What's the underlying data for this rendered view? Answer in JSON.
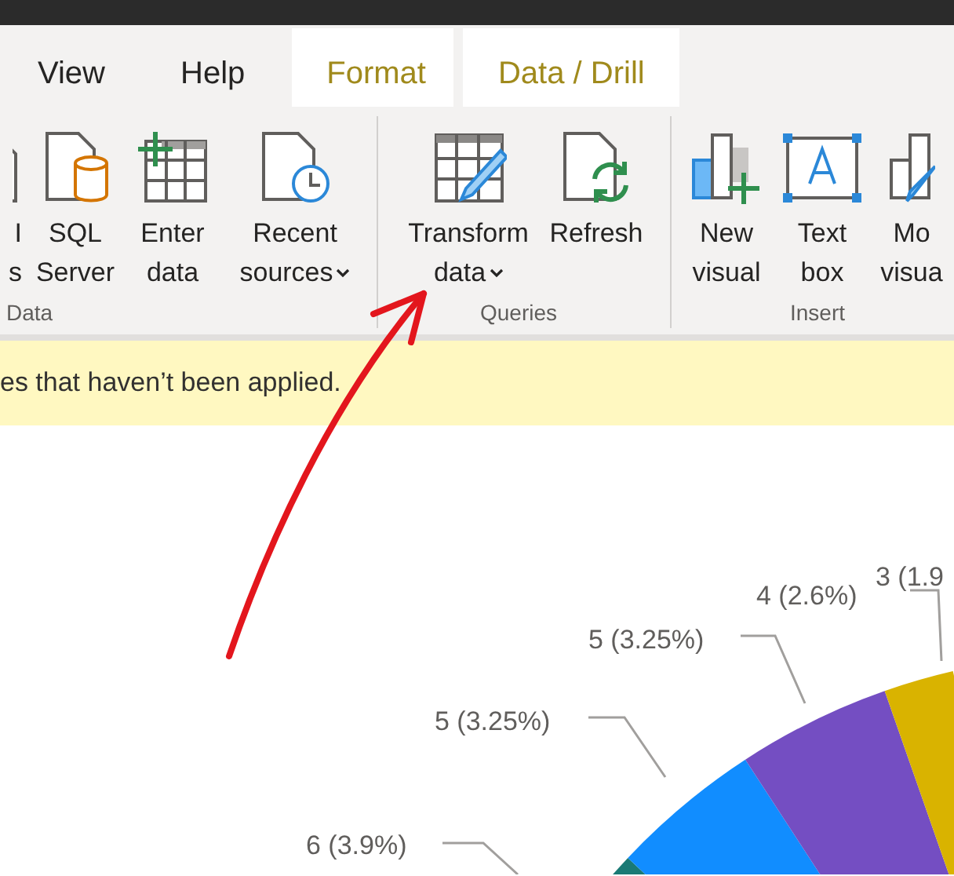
{
  "tabs": [
    {
      "label": "View",
      "kind": "normal"
    },
    {
      "label": "Help",
      "kind": "normal"
    },
    {
      "label": "Format",
      "kind": "contextual"
    },
    {
      "label": "Data / Drill",
      "kind": "contextual"
    }
  ],
  "ribbon": {
    "groups": [
      {
        "label": "Data",
        "buttons": [
          {
            "lines": [
              "I",
              "s"
            ],
            "has_dropdown": false
          },
          {
            "lines": [
              "SQL",
              "Server"
            ],
            "has_dropdown": false
          },
          {
            "lines": [
              "Enter",
              "data"
            ],
            "has_dropdown": false
          },
          {
            "lines": [
              "Recent",
              "sources"
            ],
            "has_dropdown": true
          }
        ]
      },
      {
        "label": "Queries",
        "buttons": [
          {
            "lines": [
              "Transform",
              "data"
            ],
            "has_dropdown": true
          },
          {
            "lines": [
              "Refresh"
            ],
            "has_dropdown": false
          }
        ]
      },
      {
        "label": "Insert",
        "buttons": [
          {
            "lines": [
              "New",
              "visual"
            ],
            "has_dropdown": false
          },
          {
            "lines": [
              "Text",
              "box"
            ],
            "has_dropdown": false
          },
          {
            "lines": [
              "Mo",
              "visua"
            ],
            "has_dropdown": false
          }
        ]
      }
    ]
  },
  "notification": {
    "text": "es that haven’t been applied."
  },
  "pie": {
    "slices": [
      {
        "label": "6 (3.9%)",
        "color": "#1a7a75"
      },
      {
        "label": "5 (3.25%)",
        "color": "#118dff"
      },
      {
        "label": "5 (3.25%)",
        "color": "#744ec2"
      },
      {
        "label": "4 (2.6%)",
        "color": "#d9b300"
      },
      {
        "label": "3 (1.9"
      }
    ]
  }
}
